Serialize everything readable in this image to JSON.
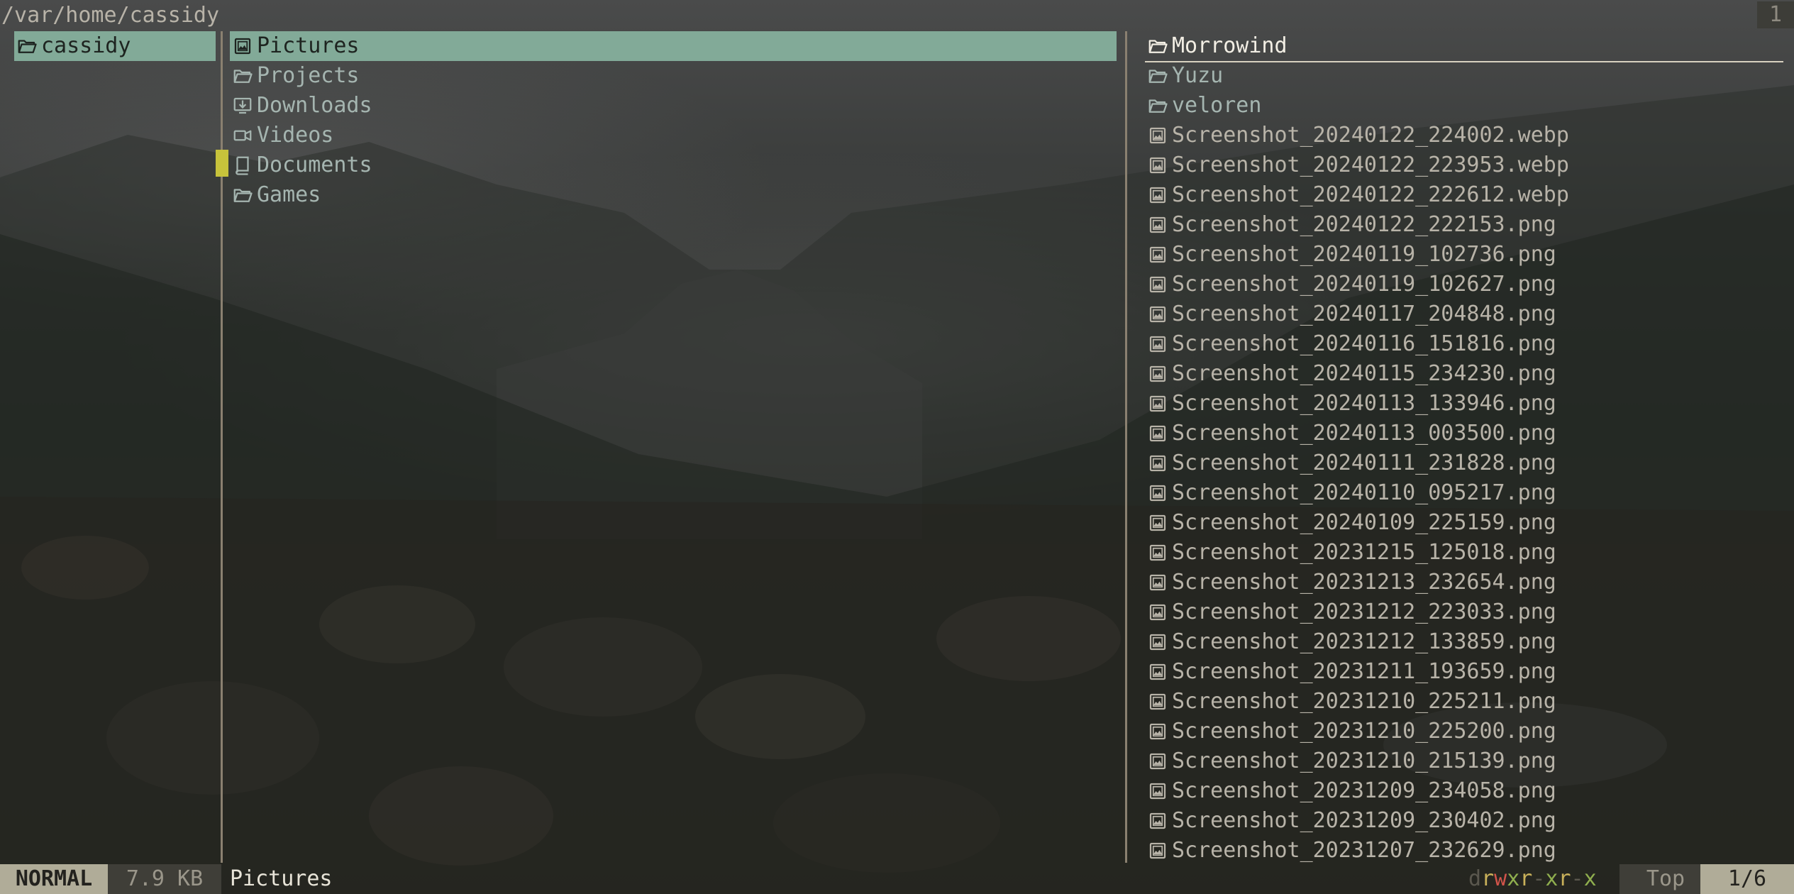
{
  "header": {
    "path": "/var/home/cassidy",
    "tab_number": "1"
  },
  "parent_pane": {
    "entries": [
      {
        "name": "cassidy",
        "icon": "folder-open-icon",
        "selected": true
      }
    ]
  },
  "current_pane": {
    "entries": [
      {
        "name": "Pictures",
        "icon": "image-icon",
        "selected": true
      },
      {
        "name": "Projects",
        "icon": "folder-open-icon"
      },
      {
        "name": "Downloads",
        "icon": "download-icon"
      },
      {
        "name": "Videos",
        "icon": "video-icon"
      },
      {
        "name": "Documents",
        "icon": "book-icon",
        "marked": true
      },
      {
        "name": "Games",
        "icon": "folder-open-icon"
      }
    ]
  },
  "preview_pane": {
    "entries": [
      {
        "name": "Morrowind",
        "icon": "folder-open-icon",
        "kind": "dir",
        "hovered": true
      },
      {
        "name": "Yuzu",
        "icon": "folder-open-icon",
        "kind": "dir"
      },
      {
        "name": "veloren",
        "icon": "folder-open-icon",
        "kind": "dir"
      },
      {
        "name": "Screenshot_20240122_224002.webp",
        "icon": "image-file-icon",
        "kind": "file"
      },
      {
        "name": "Screenshot_20240122_223953.webp",
        "icon": "image-file-icon",
        "kind": "file"
      },
      {
        "name": "Screenshot_20240122_222612.webp",
        "icon": "image-file-icon",
        "kind": "file"
      },
      {
        "name": "Screenshot_20240122_222153.png",
        "icon": "image-file-icon",
        "kind": "file"
      },
      {
        "name": "Screenshot_20240119_102736.png",
        "icon": "image-file-icon",
        "kind": "file"
      },
      {
        "name": "Screenshot_20240119_102627.png",
        "icon": "image-file-icon",
        "kind": "file"
      },
      {
        "name": "Screenshot_20240117_204848.png",
        "icon": "image-file-icon",
        "kind": "file"
      },
      {
        "name": "Screenshot_20240116_151816.png",
        "icon": "image-file-icon",
        "kind": "file"
      },
      {
        "name": "Screenshot_20240115_234230.png",
        "icon": "image-file-icon",
        "kind": "file"
      },
      {
        "name": "Screenshot_20240113_133946.png",
        "icon": "image-file-icon",
        "kind": "file"
      },
      {
        "name": "Screenshot_20240113_003500.png",
        "icon": "image-file-icon",
        "kind": "file"
      },
      {
        "name": "Screenshot_20240111_231828.png",
        "icon": "image-file-icon",
        "kind": "file"
      },
      {
        "name": "Screenshot_20240110_095217.png",
        "icon": "image-file-icon",
        "kind": "file"
      },
      {
        "name": "Screenshot_20240109_225159.png",
        "icon": "image-file-icon",
        "kind": "file"
      },
      {
        "name": "Screenshot_20231215_125018.png",
        "icon": "image-file-icon",
        "kind": "file"
      },
      {
        "name": "Screenshot_20231213_232654.png",
        "icon": "image-file-icon",
        "kind": "file"
      },
      {
        "name": "Screenshot_20231212_223033.png",
        "icon": "image-file-icon",
        "kind": "file"
      },
      {
        "name": "Screenshot_20231212_133859.png",
        "icon": "image-file-icon",
        "kind": "file"
      },
      {
        "name": "Screenshot_20231211_193659.png",
        "icon": "image-file-icon",
        "kind": "file"
      },
      {
        "name": "Screenshot_20231210_225211.png",
        "icon": "image-file-icon",
        "kind": "file"
      },
      {
        "name": "Screenshot_20231210_225200.png",
        "icon": "image-file-icon",
        "kind": "file"
      },
      {
        "name": "Screenshot_20231210_215139.png",
        "icon": "image-file-icon",
        "kind": "file"
      },
      {
        "name": "Screenshot_20231209_234058.png",
        "icon": "image-file-icon",
        "kind": "file"
      },
      {
        "name": "Screenshot_20231209_230402.png",
        "icon": "image-file-icon",
        "kind": "file"
      },
      {
        "name": "Screenshot_20231207_232629.png",
        "icon": "image-file-icon",
        "kind": "file"
      }
    ]
  },
  "status_bar": {
    "mode": "NORMAL",
    "size": "7.9 KB",
    "selected_name": "Pictures",
    "permissions": [
      {
        "char": "d",
        "color": "#5a574e"
      },
      {
        "char": "r",
        "color": "#c9b15a"
      },
      {
        "char": "w",
        "color": "#d2544a"
      },
      {
        "char": "x",
        "color": "#8fae4e"
      },
      {
        "char": "r",
        "color": "#c9b15a"
      },
      {
        "char": "-",
        "color": "#5a574e"
      },
      {
        "char": "x",
        "color": "#8fae4e"
      },
      {
        "char": "r",
        "color": "#c9b15a"
      },
      {
        "char": "-",
        "color": "#5a574e"
      },
      {
        "char": "x",
        "color": "#8fae4e"
      }
    ],
    "position": "Top",
    "count": "1/6"
  },
  "colors": {
    "selection": "#82aa98",
    "directory": "#a5b5b0",
    "mark": "#c7c33b",
    "divider": "#8a8070"
  }
}
